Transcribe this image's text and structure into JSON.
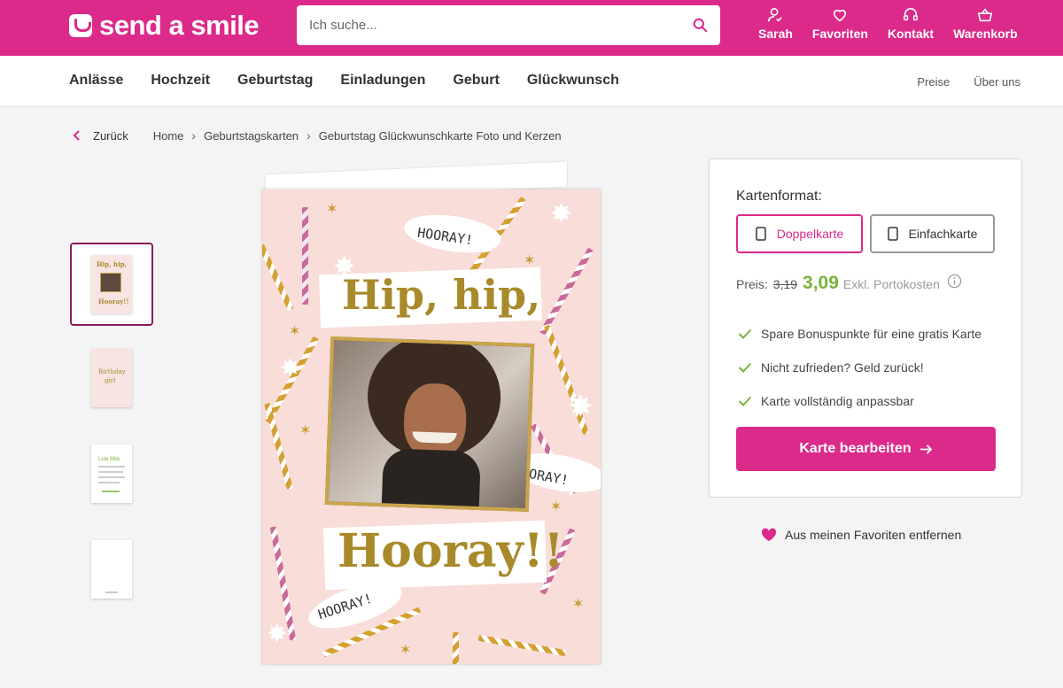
{
  "header": {
    "logo": "send a smile",
    "search_placeholder": "Ich suche...",
    "links": [
      "Sarah",
      "Favoriten",
      "Kontakt",
      "Warenkorb"
    ]
  },
  "nav": {
    "main": [
      "Anlässe",
      "Hochzeit",
      "Geburtstag",
      "Einladungen",
      "Geburt",
      "Glückwunsch"
    ],
    "aux": [
      "Preise",
      "Über uns"
    ]
  },
  "breadcrumb": {
    "back": "Zurück",
    "items": [
      "Home",
      "Geburtstagskarten",
      "Geburtstag Glückwunschkarte Foto und Kerzen"
    ]
  },
  "card": {
    "line1": "Hip, hip,",
    "line2": "Hooray!!",
    "stickers": [
      "HOORAY!",
      "OORAY!",
      "HOORAY!"
    ],
    "thumb_labels": [
      "Hip, hip, Hooray!!",
      "Birthday girl",
      "Lola Mila"
    ]
  },
  "panel": {
    "format_label": "Kartenformat:",
    "format_options": [
      "Doppelkarte",
      "Einfachkarte"
    ],
    "selected_format": "Doppelkarte",
    "price_label": "Preis:",
    "old_price": "3,19",
    "new_price": "3,09",
    "shipping": "Exkl. Portokosten",
    "usps": [
      "Spare Bonuspunkte für eine gratis Karte",
      "Nicht zufrieden? Geld zurück!",
      "Karte vollständig anpassbar"
    ],
    "cta": "Karte bearbeiten"
  },
  "favorite": "Aus meinen Favoriten entfernen",
  "colors": {
    "brand": "#dc2a8a",
    "price_green": "#7ab23a",
    "gold": "#a88a2b"
  },
  "icons": [
    "search-icon",
    "user-icon",
    "heart-icon",
    "headset-icon",
    "basket-icon",
    "chevron-left-icon",
    "chevron-right-icon",
    "card-icon",
    "info-icon",
    "check-icon",
    "arrow-right-icon"
  ]
}
